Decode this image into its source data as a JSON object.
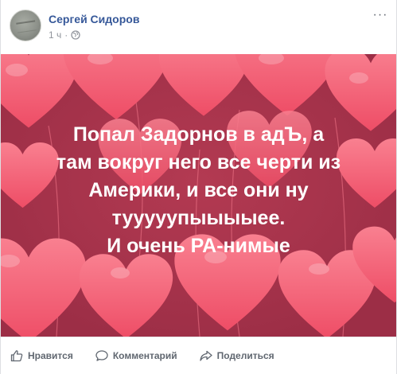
{
  "post": {
    "author": "Сергей Сидоров",
    "time": "1 ч",
    "dot": "·",
    "more": "···",
    "text": "Попал Задорнов в адЪ, а\nтам вокруг него все черти из\nАмерики, и все они ну\nтууууупыыыыее.\nИ очень РА-нимые"
  },
  "actions": {
    "like": "Нравится",
    "comment": "Комментарий",
    "share": "Поделиться"
  },
  "colors": {
    "link": "#365899",
    "background": "#c43b57",
    "heart": "#f35a70",
    "heart_light": "#f7808f"
  },
  "icons": [
    "globe-icon",
    "more-icon",
    "like-icon",
    "comment-icon",
    "share-icon",
    "heart-icon"
  ]
}
